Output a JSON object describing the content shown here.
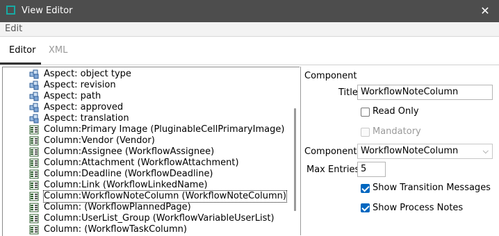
{
  "window": {
    "title": "View Editor"
  },
  "menu": {
    "edit_label": "Edit"
  },
  "tabs": [
    {
      "label": "Editor",
      "active": true
    },
    {
      "label": "XML",
      "active": false
    }
  ],
  "tree": {
    "items": [
      {
        "label": "Aspect: object type",
        "icon": "aspect-icon"
      },
      {
        "label": "Aspect: revision",
        "icon": "aspect-icon"
      },
      {
        "label": "Aspect: path",
        "icon": "aspect-icon"
      },
      {
        "label": "Aspect: approved",
        "icon": "aspect-icon"
      },
      {
        "label": "Aspect: translation",
        "icon": "aspect-icon"
      },
      {
        "label": "Column:Primary Image (PluginableCellPrimaryImage)",
        "icon": "column-icon"
      },
      {
        "label": "Column:Vendor (Vendor)",
        "icon": "column-icon"
      },
      {
        "label": "Column:Assignee (WorkflowAssignee)",
        "icon": "column-icon"
      },
      {
        "label": "Column:Attachment (WorkflowAttachment)",
        "icon": "column-icon"
      },
      {
        "label": "Column:Deadline (WorkflowDeadline)",
        "icon": "column-icon"
      },
      {
        "label": "Column:Link (WorkflowLinkedName)",
        "icon": "column-icon"
      },
      {
        "label": "Column:WorkflowNoteColumn (WorkflowNoteColumn)",
        "icon": "column-icon",
        "selected": true
      },
      {
        "label": "Column: (WorkflowPlannedPage)",
        "icon": "column-icon"
      },
      {
        "label": "Column:UserList_Group (WorkflowVariableUserList)",
        "icon": "column-icon"
      },
      {
        "label": "Column: (WorkflowTaskColumn)",
        "icon": "column-icon"
      }
    ]
  },
  "form": {
    "section_label": "Component",
    "title_label": "Title",
    "title_value": "WorkflowNoteColumn",
    "read_only_label": "Read Only",
    "read_only_checked": false,
    "mandatory_label": "Mandatory",
    "mandatory_checked": false,
    "component_label": "Component",
    "component_value": "WorkflowNoteColumn",
    "max_entries_label": "Max Entries",
    "max_entries_value": "5",
    "show_transition_label": "Show Transition Messages",
    "show_transition_checked": true,
    "show_process_label": "Show Process Notes",
    "show_process_checked": true
  },
  "colors": {
    "titlebar": "#4d4d4d",
    "accent": "#0067c0",
    "app_icon": "#18a9a3"
  }
}
